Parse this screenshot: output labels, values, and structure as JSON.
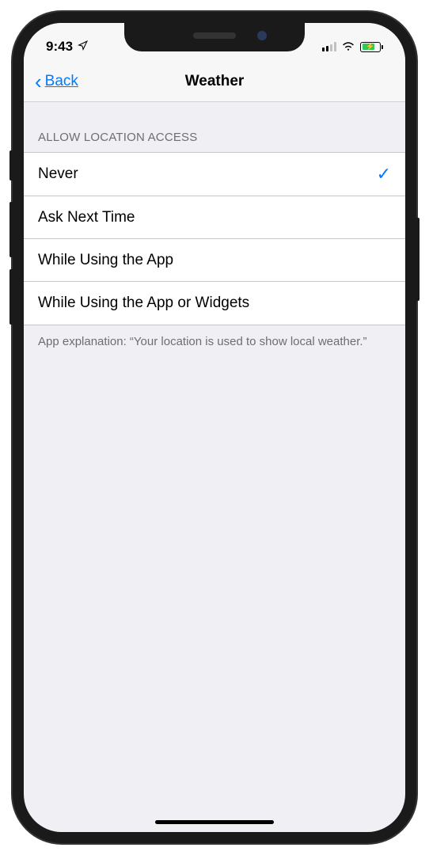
{
  "status_bar": {
    "time": "9:43"
  },
  "nav": {
    "back_label": "Back",
    "title": "Weather"
  },
  "section": {
    "header": "ALLOW LOCATION ACCESS",
    "options": [
      {
        "label": "Never",
        "selected": true
      },
      {
        "label": "Ask Next Time",
        "selected": false
      },
      {
        "label": "While Using the App",
        "selected": false
      },
      {
        "label": "While Using the App or Widgets",
        "selected": false
      }
    ],
    "footer": "App explanation: “Your location is used to show local weather.”"
  }
}
